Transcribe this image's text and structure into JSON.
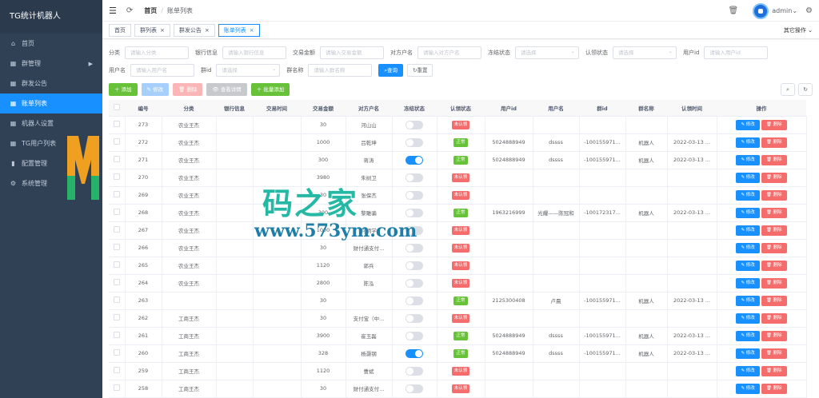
{
  "app": {
    "title": "TG统计机器人"
  },
  "sidebar": {
    "items": [
      {
        "label": "首页",
        "icon": "home-icon"
      },
      {
        "label": "群管理",
        "icon": "grid-icon",
        "expandable": true
      },
      {
        "label": "群发公告",
        "icon": "grid-icon"
      },
      {
        "label": "账单列表",
        "icon": "grid-icon",
        "active": true
      },
      {
        "label": "机器人设置",
        "icon": "grid-icon"
      },
      {
        "label": "TG用户列表",
        "icon": "grid-icon"
      },
      {
        "label": "配置管理",
        "icon": "chart-icon"
      },
      {
        "label": "系统管理",
        "icon": "gear-icon"
      }
    ]
  },
  "navbar": {
    "breadcrumb_home": "首页",
    "breadcrumb_current": "账单列表",
    "username": "admin"
  },
  "tags": {
    "items": [
      {
        "label": "首页",
        "closable": false
      },
      {
        "label": "群列表",
        "closable": true
      },
      {
        "label": "群发公告",
        "closable": true
      },
      {
        "label": "账单列表",
        "closable": true,
        "active": true
      }
    ],
    "more": "其它操作"
  },
  "search": {
    "fields": [
      {
        "label": "分类",
        "placeholder": "请输入分类",
        "type": "input"
      },
      {
        "label": "银行信息",
        "placeholder": "请输入银行信息",
        "type": "input"
      },
      {
        "label": "交易金额",
        "placeholder": "请输入交易金额",
        "type": "input"
      },
      {
        "label": "对方户名",
        "placeholder": "请输入对方户名",
        "type": "input"
      },
      {
        "label": "冻结状态",
        "placeholder": "请选择",
        "type": "select"
      },
      {
        "label": "认领状态",
        "placeholder": "请选择",
        "type": "select"
      },
      {
        "label": "用户id",
        "placeholder": "请输入用户id",
        "type": "input"
      },
      {
        "label": "用户名",
        "placeholder": "请输入用户名",
        "type": "input"
      },
      {
        "label": "群id",
        "placeholder": "请选择",
        "type": "select"
      },
      {
        "label": "群名称",
        "placeholder": "请输入群名称",
        "type": "input"
      }
    ],
    "query_label": "查询",
    "reset_label": "重置"
  },
  "toolbar": {
    "add_label": "添加",
    "edit_label": "修改",
    "delete_label": "删除",
    "detail_label": "查看详情",
    "batch_add_label": "批量添加"
  },
  "table": {
    "headers": [
      "编号",
      "分类",
      "银行信息",
      "交易时间",
      "交易金额",
      "对方户名",
      "冻结状态",
      "认领状态",
      "用户id",
      "用户名",
      "群id",
      "群名称",
      "认领时间",
      "操作"
    ],
    "edit_label": "修改",
    "delete_label": "删除",
    "status_ok": "正常",
    "status_no": "未认领",
    "rows": [
      {
        "id": "273",
        "cat": "农业王杰",
        "bank": "",
        "time": "",
        "amount": "30",
        "name": "河山山",
        "frozen": false,
        "claim": "no",
        "uid": "",
        "uname": "",
        "gid": "",
        "gname": "",
        "ctime": ""
      },
      {
        "id": "272",
        "cat": "农业王杰",
        "bank": "",
        "time": "",
        "amount": "1000",
        "name": "吕乾坤",
        "frozen": false,
        "claim": "ok",
        "uid": "5024888949",
        "uname": "dssss",
        "gid": "-100155971...",
        "gname": "机器人",
        "ctime": "2022-03-13 ..."
      },
      {
        "id": "271",
        "cat": "农业王杰",
        "bank": "",
        "time": "",
        "amount": "300",
        "name": "蒋涛",
        "frozen": true,
        "claim": "ok",
        "uid": "5024888949",
        "uname": "dssss",
        "gid": "-100155971...",
        "gname": "机器人",
        "ctime": "2022-03-13 ..."
      },
      {
        "id": "270",
        "cat": "农业王杰",
        "bank": "",
        "time": "",
        "amount": "3980",
        "name": "朱树卫",
        "frozen": false,
        "claim": "no",
        "uid": "",
        "uname": "",
        "gid": "",
        "gname": "",
        "ctime": ""
      },
      {
        "id": "269",
        "cat": "农业王杰",
        "bank": "",
        "time": "",
        "amount": "30",
        "name": "张保杰",
        "frozen": false,
        "claim": "no",
        "uid": "",
        "uname": "",
        "gid": "",
        "gname": "",
        "ctime": ""
      },
      {
        "id": "268",
        "cat": "农业王杰",
        "bank": "",
        "time": "",
        "amount": "300",
        "name": "黎雕骗",
        "frozen": false,
        "claim": "ok",
        "uid": "1963216999",
        "uname": "光耀——陈冠和",
        "gid": "-100172317...",
        "gname": "机器人",
        "ctime": "2022-03-13 ..."
      },
      {
        "id": "267",
        "cat": "农业王杰",
        "bank": "",
        "time": "",
        "amount": "1000",
        "name": "何炳学",
        "frozen": false,
        "claim": "no",
        "uid": "",
        "uname": "",
        "gid": "",
        "gname": "",
        "ctime": ""
      },
      {
        "id": "266",
        "cat": "农业王杰",
        "bank": "",
        "time": "",
        "amount": "30",
        "name": "财付通支付...",
        "frozen": false,
        "claim": "no",
        "uid": "",
        "uname": "",
        "gid": "",
        "gname": "",
        "ctime": ""
      },
      {
        "id": "265",
        "cat": "农业王杰",
        "bank": "",
        "time": "",
        "amount": "1120",
        "name": "郭兵",
        "frozen": false,
        "claim": "no",
        "uid": "",
        "uname": "",
        "gid": "",
        "gname": "",
        "ctime": ""
      },
      {
        "id": "264",
        "cat": "农业王杰",
        "bank": "",
        "time": "",
        "amount": "2800",
        "name": "陈泓",
        "frozen": false,
        "claim": "no",
        "uid": "",
        "uname": "",
        "gid": "",
        "gname": "",
        "ctime": ""
      },
      {
        "id": "263",
        "cat": "",
        "bank": "",
        "time": "",
        "amount": "30",
        "name": "",
        "frozen": false,
        "claim": "ok",
        "uid": "2125300408",
        "uname": "卢晨",
        "gid": "-100155971...",
        "gname": "机器人",
        "ctime": "2022-03-13 ..."
      },
      {
        "id": "262",
        "cat": "工商王杰",
        "bank": "",
        "time": "",
        "amount": "30",
        "name": "支付宝（中...",
        "frozen": false,
        "claim": "no",
        "uid": "",
        "uname": "",
        "gid": "",
        "gname": "",
        "ctime": ""
      },
      {
        "id": "261",
        "cat": "工商王杰",
        "bank": "",
        "time": "",
        "amount": "3900",
        "name": "崔玉磊",
        "frozen": false,
        "claim": "ok",
        "uid": "5024888949",
        "uname": "dssss",
        "gid": "-100155971...",
        "gname": "机器人",
        "ctime": "2022-03-13 ..."
      },
      {
        "id": "260",
        "cat": "工商王杰",
        "bank": "",
        "time": "",
        "amount": "328",
        "name": "杨灏钢",
        "frozen": true,
        "claim": "ok",
        "uid": "5024888949",
        "uname": "dssss",
        "gid": "-100155971...",
        "gname": "机器人",
        "ctime": "2022-03-13 ..."
      },
      {
        "id": "259",
        "cat": "工商王杰",
        "bank": "",
        "time": "",
        "amount": "1120",
        "name": "曹斌",
        "frozen": false,
        "claim": "no",
        "uid": "",
        "uname": "",
        "gid": "",
        "gname": "",
        "ctime": ""
      },
      {
        "id": "258",
        "cat": "工商王杰",
        "bank": "",
        "time": "",
        "amount": "30",
        "name": "财付通支付...",
        "frozen": false,
        "claim": "no",
        "uid": "",
        "uname": "",
        "gid": "",
        "gname": "",
        "ctime": ""
      }
    ]
  },
  "watermark": {
    "text": "码之家",
    "url": "www.573ym.com"
  },
  "colors": {
    "sidebar_bg": "#304156",
    "primary": "#1890ff",
    "success": "#67c23a",
    "danger": "#f56c6c"
  }
}
